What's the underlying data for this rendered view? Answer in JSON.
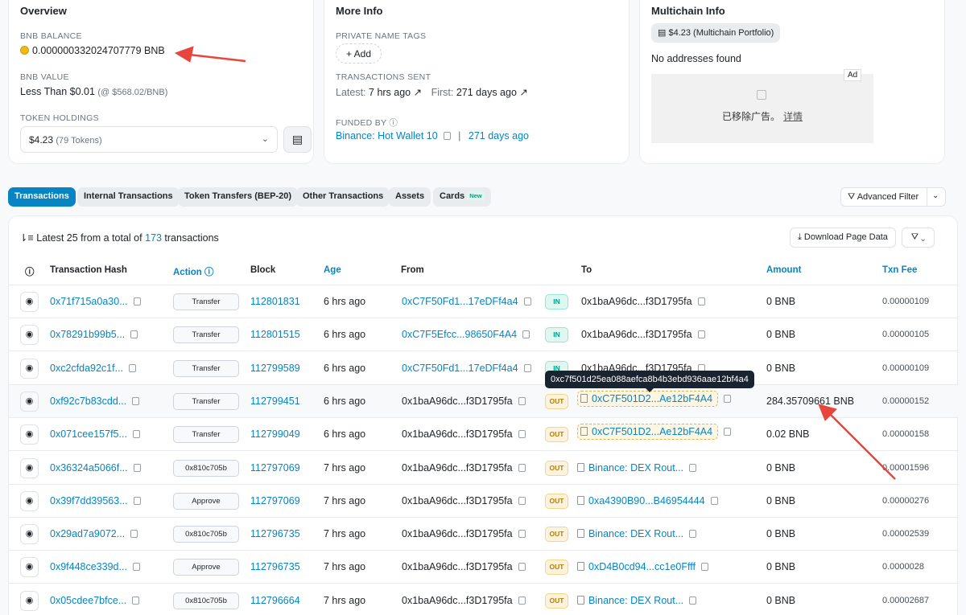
{
  "overview": {
    "title": "Overview",
    "bnb_balance_label": "BNB BALANCE",
    "bnb_balance": "0.000000332024707779 BNB",
    "bnb_value_label": "BNB VALUE",
    "bnb_value": "Less Than $0.01",
    "bnb_price": "(@ $568.02/BNB)",
    "token_holdings_label": "TOKEN HOLDINGS",
    "token_holdings_value": "$4.23",
    "token_holdings_count": "(79 Tokens)"
  },
  "more_info": {
    "title": "More Info",
    "private_tags_label": "PRIVATE NAME TAGS",
    "add_label": "+ Add",
    "tx_sent_label": "TRANSACTIONS SENT",
    "latest_label": "Latest:",
    "latest_value": "7 hrs ago",
    "first_label": "First:",
    "first_value": "271 days ago",
    "funded_by_label": "FUNDED BY",
    "funded_by_value": "Binance: Hot Wallet 10",
    "funded_age": "271 days ago"
  },
  "multichain": {
    "title": "Multichain Info",
    "portfolio": "$4.23 (Multichain Portfolio)",
    "no_addresses": "No addresses found",
    "ad_tag": "Ad",
    "ad_removed": "已移除广告。",
    "ad_details": "详情"
  },
  "tabs": [
    {
      "label": "Transactions"
    },
    {
      "label": "Internal Transactions"
    },
    {
      "label": "Token Transfers (BEP-20)"
    },
    {
      "label": "Other Transactions"
    },
    {
      "label": "Assets"
    },
    {
      "label": "Cards",
      "badge": "New"
    }
  ],
  "advanced_filter": "Advanced Filter",
  "summary": {
    "prefix": "Latest 25 from a total of",
    "total": "173",
    "suffix": "transactions"
  },
  "download_label": "Download Page Data",
  "columns": {
    "hash": "Transaction Hash",
    "action": "Action",
    "block": "Block",
    "age": "Age",
    "from": "From",
    "to": "To",
    "amount": "Amount",
    "fee": "Txn Fee"
  },
  "tooltip": "0xc7f501d25ea088aefca8b4b3ebd936aae12bf4a4",
  "rows": [
    {
      "hash": "0x71f715a0a30...",
      "action": "Transfer",
      "block": "112801831",
      "age": "6 hrs ago",
      "from": "0xC7F50Fd1...17eDFf4a4",
      "dir": "IN",
      "to": "0x1baA96dc...f3D1795fa",
      "amount": "0 BNB",
      "fee": "0.00000109"
    },
    {
      "hash": "0x78291b99b5...",
      "action": "Transfer",
      "block": "112801515",
      "age": "6 hrs ago",
      "from": "0xC7F5Efcc...98650F4A4",
      "dir": "IN",
      "to": "0x1baA96dc...f3D1795fa",
      "amount": "0 BNB",
      "fee": "0.00000105"
    },
    {
      "hash": "0xc2cfda92c1f...",
      "action": "Transfer",
      "block": "112799589",
      "age": "6 hrs ago",
      "from": "0xC7F50Fd1...17eDFf4a4",
      "dir": "IN",
      "to": "0x1baA96dc...f3D1795fa",
      "amount": "0 BNB",
      "fee": "0.00000109"
    },
    {
      "hash": "0xf92c7b83cdd...",
      "action": "Transfer",
      "block": "112799451",
      "age": "6 hrs ago",
      "from": "0x1baA96dc...f3D1795fa",
      "dir": "OUT",
      "to": "0xC7F501D2...Ae12bF4A4",
      "amount": "284.35709661 BNB",
      "fee": "0.00000152"
    },
    {
      "hash": "0x071cee157f5...",
      "action": "Transfer",
      "block": "112799049",
      "age": "6 hrs ago",
      "from": "0x1baA96dc...f3D1795fa",
      "dir": "OUT",
      "to": "0xC7F501D2...Ae12bF4A4",
      "amount": "0.02 BNB",
      "fee": "0.00000158"
    },
    {
      "hash": "0x36324a5066f...",
      "action": "0x810c705b",
      "block": "112797069",
      "age": "7 hrs ago",
      "from": "0x1baA96dc...f3D1795fa",
      "dir": "OUT",
      "to": "Binance: DEX Rout...",
      "amount": "0 BNB",
      "fee": "0.00001596"
    },
    {
      "hash": "0x39f7dd39563...",
      "action": "Approve",
      "block": "112797069",
      "age": "7 hrs ago",
      "from": "0x1baA96dc...f3D1795fa",
      "dir": "OUT",
      "to": "0xa4390B90...B46954444",
      "amount": "0 BNB",
      "fee": "0.00000276"
    },
    {
      "hash": "0x29ad7a9072...",
      "action": "0x810c705b",
      "block": "112796735",
      "age": "7 hrs ago",
      "from": "0x1baA96dc...f3D1795fa",
      "dir": "OUT",
      "to": "Binance: DEX Rout...",
      "amount": "0 BNB",
      "fee": "0.00002539"
    },
    {
      "hash": "0x9f448ce339d...",
      "action": "Approve",
      "block": "112796735",
      "age": "7 hrs ago",
      "from": "0x1baA96dc...f3D1795fa",
      "dir": "OUT",
      "to": "0xD4B0cd94...cc1e0Ffff",
      "amount": "0 BNB",
      "fee": "0.0000028"
    },
    {
      "hash": "0x05cdee7bfce...",
      "action": "0x810c705b",
      "block": "112796664",
      "age": "7 hrs ago",
      "from": "0x1baA96dc...f3D1795fa",
      "dir": "OUT",
      "to": "Binance: DEX Rout...",
      "amount": "0 BNB",
      "fee": "0.00002687"
    }
  ]
}
